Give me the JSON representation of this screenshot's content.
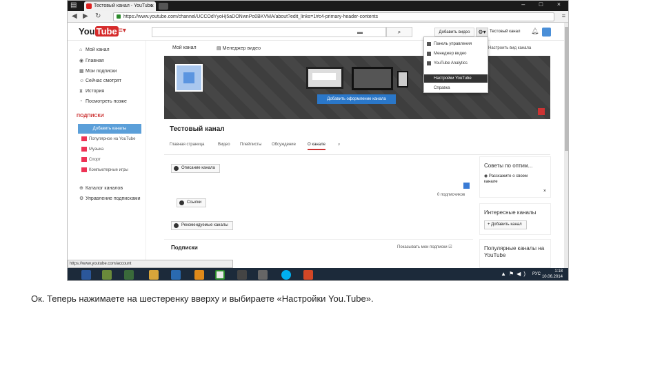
{
  "browser": {
    "tab_title": "Тестовый канал - YouTube",
    "tab_close": "×",
    "url": "https://www.youtube.com/channel/UCCOdYyoHj5aDONwnPo0BKVMA/about?edit_links=1#c4-primary-header-contents",
    "window_controls": "– □ ×"
  },
  "header": {
    "logo_you": "You",
    "logo_tube": "Tube",
    "add_video": "Добавить видео",
    "username": "Тестовый канал"
  },
  "sidebar": {
    "items": [
      {
        "label": "Мой канал",
        "icon": "home-icon"
      },
      {
        "label": "Главная",
        "icon": "globe-icon"
      },
      {
        "label": "Мои подписки",
        "icon": "subscriptions-icon"
      },
      {
        "label": "Сейчас смотрят",
        "icon": "people-icon"
      },
      {
        "label": "История",
        "icon": "hourglass-icon"
      },
      {
        "label": "Посмотреть позже",
        "icon": "clock-icon"
      }
    ],
    "subs_header": "ПОДПИСКИ",
    "add_channels": "Добавить каналы",
    "subscriptions": [
      "Популярное на YouTube",
      "Музыка",
      "Спорт",
      "Компьютерные игры"
    ],
    "bottom": [
      "Каталог каналов",
      "Управление подписками"
    ]
  },
  "channel_nav": {
    "feed": "Мой канал",
    "manager": "Менеджер видео"
  },
  "banner": {
    "add_art": "Добавить оформление канала"
  },
  "channel": {
    "title": "Тестовый канал",
    "tabs": [
      "Главная страница",
      "Видео",
      "Плейлисты",
      "Обсуждение",
      "О канале"
    ]
  },
  "about": {
    "description_btn": "Описание канала",
    "links_btn": "Ссылки",
    "featured_btn": "Рекомендуемые каналы",
    "subscribers": "0 подписчиков"
  },
  "subscriptions_section": {
    "title": "Подписки",
    "right": "Показывать мои подписки"
  },
  "right_panel": {
    "tips_title": "Советы по оптим...",
    "tips_item": "Расскажите о своем канале",
    "interesting": "Интересные каналы",
    "add_channel": "+ Добавить канал",
    "popular": "Популярные каналы на YouTube"
  },
  "dropdown": {
    "items": [
      "Панель управления",
      "Менеджер видео",
      "YouTube Analytics",
      "Настройки YouTube",
      "Справка"
    ],
    "highlighted": 3,
    "right_link": "Настроить вид канала"
  },
  "statusbar": "https://www.youtube.com/account",
  "taskbar": {
    "lang": "РУС",
    "time": "1:18",
    "date": "10.06.2014"
  },
  "caption": "Ок. Теперь нажимаете на шестеренку вверху и выбираете «Настройки You.Tube».",
  "colors": {
    "accent": "#d62b2b",
    "link_blue": "#2a77c9",
    "taskbar": "#1c2a3a"
  }
}
